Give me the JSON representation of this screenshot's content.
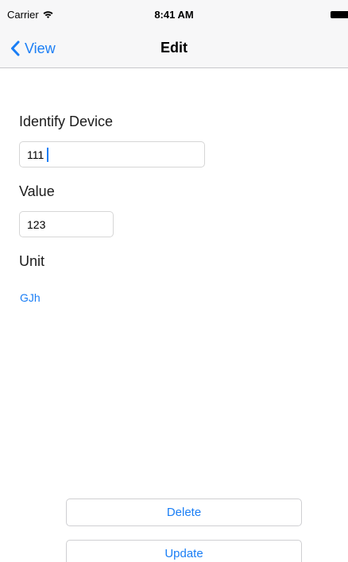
{
  "status_bar": {
    "carrier": "Carrier",
    "time": "8:41 AM",
    "wifi_icon": "wifi-icon",
    "battery_icon": "battery-icon"
  },
  "nav": {
    "back_label": "View",
    "back_icon": "chevron-left-icon",
    "title": "Edit"
  },
  "form": {
    "identify_device": {
      "label": "Identify Device",
      "value": "111"
    },
    "value_field": {
      "label": "Value",
      "value": "123"
    },
    "unit": {
      "label": "Unit",
      "value": "GJh"
    }
  },
  "actions": {
    "delete_label": "Delete",
    "update_label": "Update"
  },
  "colors": {
    "accent": "#1a7ef5",
    "bar_background": "#f7f7f8",
    "separator": "#c8c7cc"
  }
}
